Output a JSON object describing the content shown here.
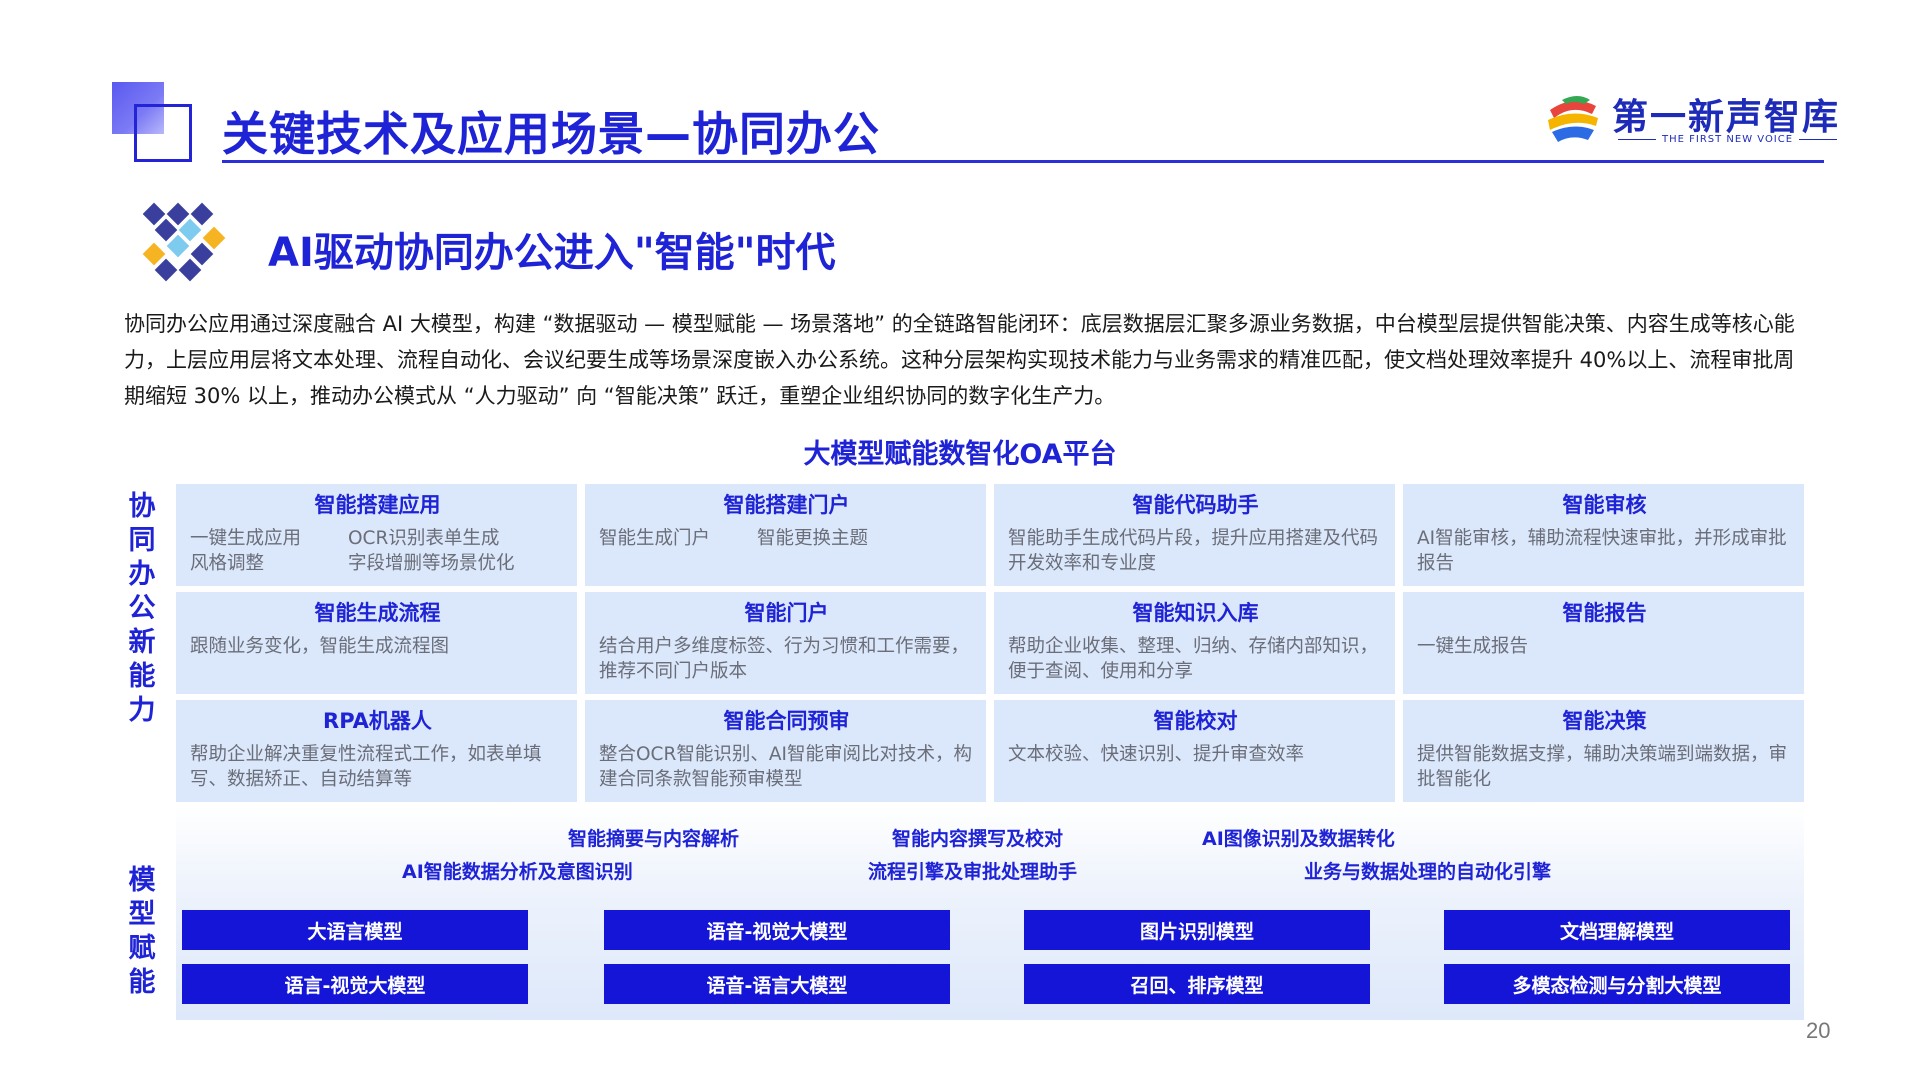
{
  "header": {
    "title": "关键技术及应用场景—协同办公",
    "logo": {
      "name": "第一新声智库",
      "subtitle": "THE FIRST NEW VOICE"
    }
  },
  "section": {
    "title": "AI驱动协同办公进入\"智能\"时代",
    "intro": "协同办公应用通过深度融合 AI 大模型，构建 “数据驱动 — 模型赋能 — 场景落地” 的全链路智能闭环：底层数据层汇聚多源业务数据，中台模型层提供智能决策、内容生成等核心能力，上层应用层将文本处理、流程自动化、会议纪要生成等场景深度嵌入办公系统。这种分层架构实现技术能力与业务需求的精准匹配，使文档处理效率提升 40%以上、流程审批周期缩短 30% 以上，推动办公模式从 “人力驱动” 向 “智能决策” 跃迁，重塑企业组织协同的数字化生产力。"
  },
  "platform": {
    "title": "大模型赋能数智化OA平台",
    "label_top": "协同办公新能力",
    "label_bottom": "模型赋能",
    "cells": [
      {
        "title": "智能搭建应用",
        "desc": [
          "一键生成应用",
          "OCR识别表单生成",
          "风格调整",
          "字段增删等场景优化"
        ]
      },
      {
        "title": "智能搭建门户",
        "desc": [
          "智能生成门户",
          "智能更换主题"
        ]
      },
      {
        "title": "智能代码助手",
        "desc": [
          "智能助手生成代码片段，提升应用搭建及代码开发效率和专业度"
        ]
      },
      {
        "title": "智能审核",
        "desc": [
          "AI智能审核，辅助流程快速审批，并形成审批报告"
        ]
      },
      {
        "title": "智能生成流程",
        "desc": [
          "跟随业务变化，智能生成流程图"
        ]
      },
      {
        "title": "智能门户",
        "desc": [
          "结合用户多维度标签、行为习惯和工作需要，推荐不同门户版本"
        ]
      },
      {
        "title": "智能知识入库",
        "desc": [
          "帮助企业收集、整理、归纳、存储内部知识，便于查阅、使用和分享"
        ]
      },
      {
        "title": "智能报告",
        "desc": [
          "一键生成报告"
        ]
      },
      {
        "title": "RPA机器人",
        "desc": [
          "帮助企业解决重复性流程式工作，如表单填写、数据矫正、自动结算等"
        ]
      },
      {
        "title": "智能合同预审",
        "desc": [
          "整合OCR智能识别、AI智能审阅比对技术，构建合同条款智能预审模型"
        ]
      },
      {
        "title": "智能校对",
        "desc": [
          "文本校验、快速识别、提升审查效率"
        ]
      },
      {
        "title": "智能决策",
        "desc": [
          "提供智能数据支撑，辅助决策端到端数据，审批智能化"
        ]
      }
    ],
    "capabilities": [
      "智能摘要与内容解析",
      "智能内容撰写及校对",
      "AI图像识别及数据转化",
      "AI智能数据分析及意图识别",
      "流程引擎及审批处理助手",
      "业务与数据处理的自动化引擎"
    ],
    "models": [
      "大语言模型",
      "语音-视觉大模型",
      "图片识别模型",
      "文档理解模型",
      "语言-视觉大模型",
      "语音-语言大模型",
      "召回、排序模型",
      "多模态检测与分割大模型"
    ]
  },
  "page_number": "20",
  "colors": {
    "brand": "#1f23d6",
    "cell_bg": "#dbe7fb",
    "model_bg": "#1515d8",
    "desc": "#6a6e78"
  },
  "icons": [
    "corner-square-decoration",
    "logo-mark",
    "diamond-cluster-icon"
  ]
}
